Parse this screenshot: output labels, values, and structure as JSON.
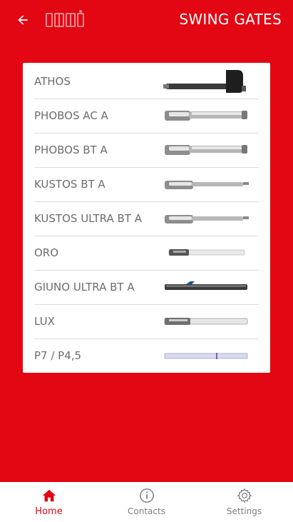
{
  "header": {
    "title": "SWING GATES",
    "back_icon": "arrow-left-icon",
    "logo_icon": "brand-logo-icon"
  },
  "colors": {
    "primary": "#e30613",
    "card": "#ffffff",
    "text": "#6d6d6d",
    "inactive": "#808080"
  },
  "products": [
    {
      "label": "ATHOS",
      "icon": "athos-operator-image"
    },
    {
      "label": "PHOBOS AC A",
      "icon": "phobos-ac-operator-image"
    },
    {
      "label": "PHOBOS BT A",
      "icon": "phobos-bt-operator-image"
    },
    {
      "label": "KUSTOS BT A",
      "icon": "kustos-bt-operator-image"
    },
    {
      "label": "KUSTOS ULTRA BT A",
      "icon": "kustos-ultra-operator-image"
    },
    {
      "label": "ORO",
      "icon": "oro-operator-image"
    },
    {
      "label": "GIUNO ULTRA BT A",
      "icon": "giuno-operator-image"
    },
    {
      "label": "LUX",
      "icon": "lux-operator-image"
    },
    {
      "label": "P7 / P4,5",
      "icon": "p7-operator-image"
    }
  ],
  "bottom_nav": [
    {
      "label": "Home",
      "icon": "home-icon",
      "active": true
    },
    {
      "label": "Contacts",
      "icon": "info-icon",
      "active": false
    },
    {
      "label": "Settings",
      "icon": "gear-icon",
      "active": false
    }
  ]
}
